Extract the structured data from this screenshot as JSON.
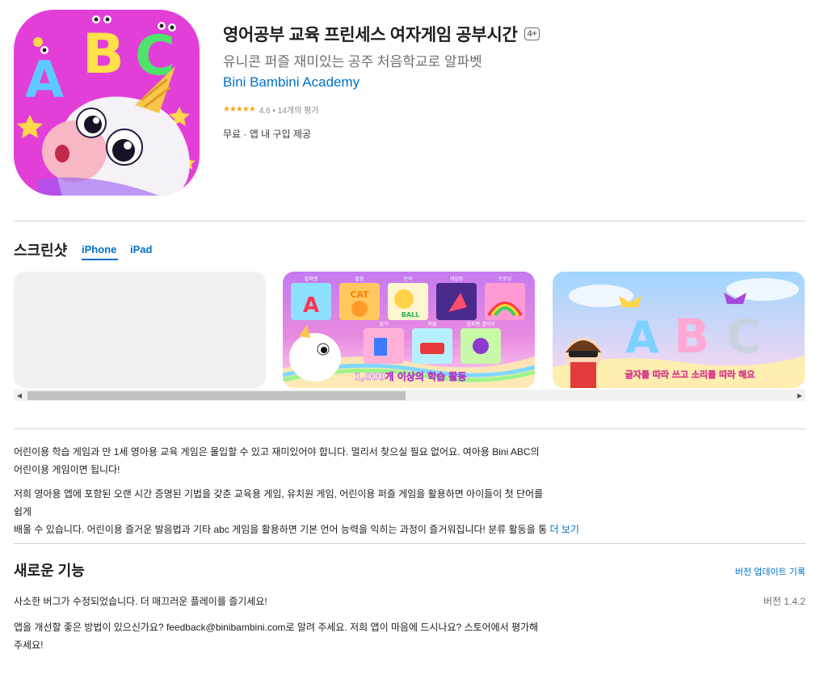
{
  "app": {
    "title": "영어공부 교육 프린세스 여자게임 공부시간",
    "age_rating": "4+",
    "subtitle": "유니콘 퍼즐 재미있는 공주 처음학교로 알파벳",
    "developer": "Bini Bambini Academy",
    "rating_stars": "★★★★★",
    "rating_text": "4.6 • 14개의 평가",
    "rating_value": 4.6,
    "price_text": "무료 · 앱 내 구입 제공",
    "icon_letters": [
      "A",
      "B",
      "C"
    ]
  },
  "screenshots": {
    "title": "스크린샷",
    "tabs": [
      "iPhone",
      "iPad"
    ],
    "shot2_labels": [
      "알파벳",
      "발음",
      "단어",
      "게임방",
      "트로잉",
      "읽기",
      "퍼즐",
      "알파벳 갤러리"
    ],
    "shot2_tile_words": [
      "A",
      "CAT",
      "BALL"
    ],
    "shot2_caption": "1,000개 이상의 학습 활동",
    "shot3_letters": [
      "A",
      "B",
      "C"
    ],
    "shot3_caption": "글자를 따라 쓰고 소리를 따라 해요"
  },
  "description": {
    "line1": "어린이용 학습 게임과 만 1세 영아용 교육 게임은 몰입할 수 있고 재미있어야 합니다. 멀리서 찾으실 필요 없어요. 여아용 Bini ABC의",
    "line2": "어린이용 게임이면 됩니다!",
    "line3": "저희 영아용 앱에 포함된 오랜 시간 증명된 기법을 갖춘 교육용 게임, 유치원 게임, 어린이용 퍼즐 게임을 활용하면 아이들이 첫 단어를 쉽게",
    "line4": "배울 수 있습니다. 어린이용 즐거운 발음법과 기타 abc 게임을 활용하면 기본 언어 능력을 익히는 과정이 즐거워집니다! 분류 활동을 통",
    "more_label": "더 보기"
  },
  "whats_new": {
    "title": "새로운 기능",
    "history_link": "버전 업데이트 기록",
    "note1": "사소한 버그가 수정되었습니다. 더 매끄러운 플레이를 즐기세요!",
    "version": "버전 1.4.2",
    "note2_line1": "앱을 개선할 좋은 방법이 있으신가요? feedback@binibambini.com로 알려 주세요. 저희 앱이 마음에 드시나요? 스토어에서 평가해",
    "note2_line2": "주세요!"
  }
}
